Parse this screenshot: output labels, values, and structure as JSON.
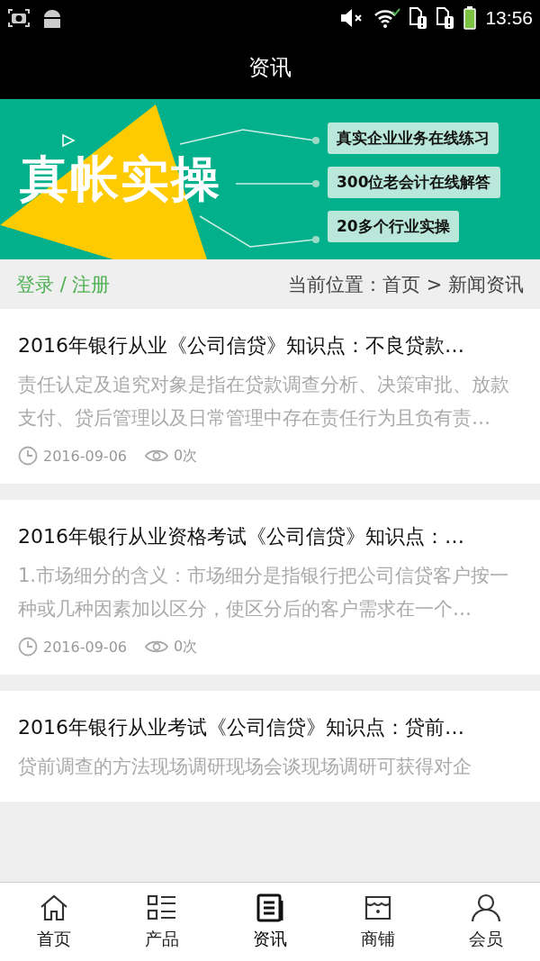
{
  "status_bar": {
    "time": "13:56"
  },
  "header": {
    "title": "资讯"
  },
  "banner": {
    "headline": "真帐实操",
    "points": [
      "真实企业业务在线练习",
      "300位老会计在线解答",
      "20多个行业实操"
    ]
  },
  "breadcrumb": {
    "login": "登录 / 注册",
    "location": "当前位置：首页 > 新闻资讯"
  },
  "articles": [
    {
      "title": "2016年银行从业《公司信贷》知识点：不良贷款…",
      "excerpt": "责任认定及追究对象是指在贷款调查分析、决策审批、放款支付、贷后管理以及日常管理中存在责任行为且负有责…",
      "date": "2016-09-06",
      "views": "0次"
    },
    {
      "title": "2016年银行从业资格考试《公司信贷》知识点：…",
      "excerpt": "1.市场细分的含义：市场细分是指银行把公司信贷客户按一种或几种因素加以区分，使区分后的客户需求在一个…",
      "date": "2016-09-06",
      "views": "0次"
    },
    {
      "title": "2016年银行从业考试《公司信贷》知识点：贷前…",
      "excerpt": "贷前调查的方法现场调研现场会谈现场调研可获得对企"
    }
  ],
  "tabs": [
    {
      "kind": "home",
      "label": "首页",
      "selected": false
    },
    {
      "kind": "products",
      "label": "产品",
      "selected": false
    },
    {
      "kind": "news",
      "label": "资讯",
      "selected": true
    },
    {
      "kind": "shop",
      "label": "商铺",
      "selected": false
    },
    {
      "kind": "member",
      "label": "会员",
      "selected": false
    }
  ]
}
